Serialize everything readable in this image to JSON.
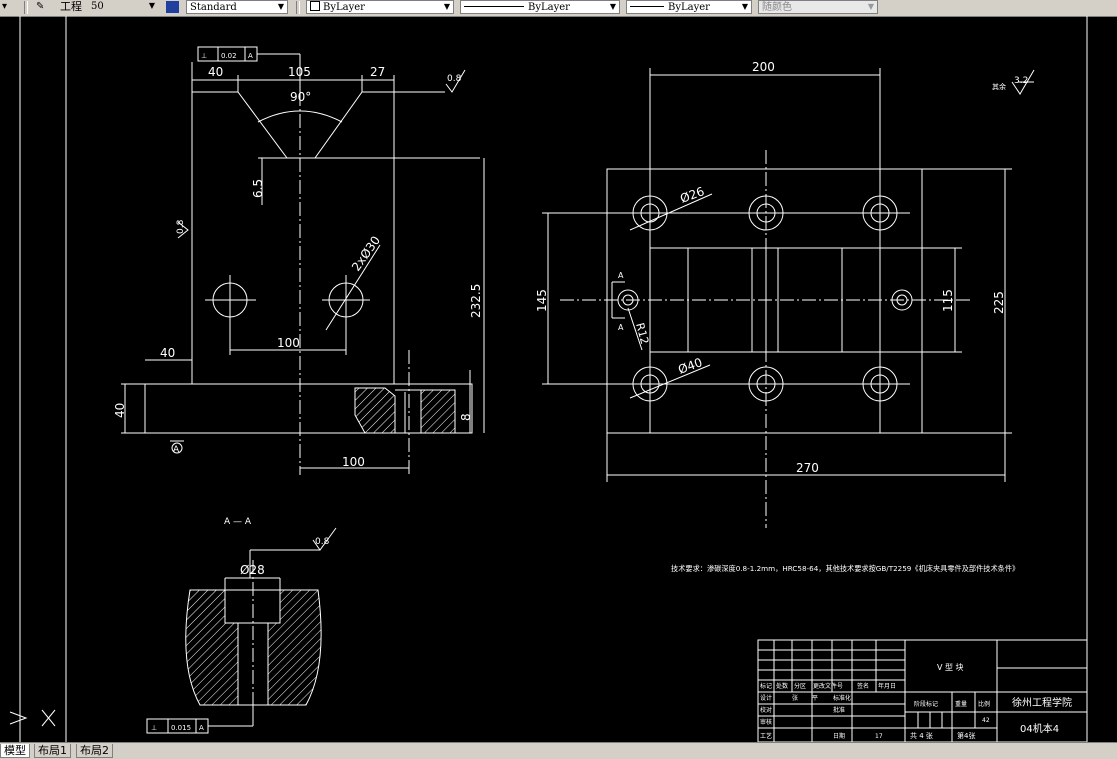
{
  "toolbar": {
    "layer_name": "工程",
    "layer_scale": "50",
    "text_style": "Standard",
    "layer_combo": "ByLayer",
    "linetype_combo": "ByLayer",
    "lineweight_combo": "ByLayer",
    "color_combo": "随颜色"
  },
  "layout_tabs": [
    "模型",
    "布局1",
    "布局2"
  ],
  "drawing": {
    "front_view": {
      "tolerance_top": {
        "symbol": "⊥",
        "value": "0.02",
        "datum": "A"
      },
      "dim_40_top": "40",
      "dim_105": "105",
      "dim_27": "27",
      "angle_90": "90°",
      "roughness_top": "0.8",
      "dim_6_5": "6.5",
      "roughness_left": "0.8",
      "holes_label": "2xØ30",
      "dim_232_5": "232.5",
      "dim_100_mid": "100",
      "dim_40_left": "40",
      "dim_40_base": "40",
      "dim_8": "8",
      "dim_100_bottom": "100",
      "datum_a": "A"
    },
    "top_view": {
      "dim_200": "200",
      "hole_26": "Ø26",
      "hole_40": "Ø40",
      "dim_145": "145",
      "dim_115": "115",
      "dim_225": "225",
      "dim_270": "270",
      "radius_r12": "R12",
      "section_a_top": "A",
      "section_a_bottom": "A"
    },
    "section_view": {
      "title": "A — A",
      "roughness": "0.8",
      "bore": "Ø28",
      "tolerance": {
        "symbol": "⊥",
        "value": "0.015",
        "datum": "A"
      }
    },
    "general_roughness": {
      "label": "其余",
      "value": "3.2"
    },
    "tech_requirements": "技术要求：渗碳深度0.8-1.2mm，HRC58-64，其他技术要求按GB/T2259《机床夹具零件及部件技术条件》",
    "title_block": {
      "part_name": "V 型 块",
      "school": "徐州工程学院",
      "class_code": "04机本4",
      "scale_value": "42",
      "headers": [
        "标记",
        "处数",
        "分区",
        "更改文件号",
        "签名",
        "年月日"
      ],
      "row_design": [
        "设计",
        "张",
        "平",
        "标准化"
      ],
      "row_check": "校对",
      "row_audit": "审核",
      "row_approve": "批准",
      "row_process": "工艺",
      "stage_label": "阶段标记",
      "weight_label": "重量",
      "scale_label": "比例",
      "sheets_total": "共 4 张",
      "sheet_no": "第4张",
      "date_label": "日期",
      "date_value": "17"
    }
  }
}
